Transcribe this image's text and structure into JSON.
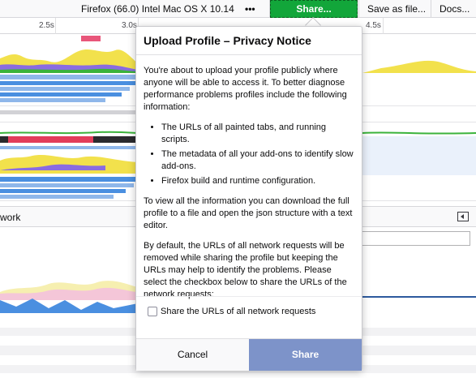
{
  "toolbar": {
    "platform": "Firefox (66.0) Intel Mac OS X 10.14",
    "more": "•••",
    "share": "Share...",
    "save_as_file": "Save as file...",
    "docs": "Docs..."
  },
  "ruler": {
    "ticks": [
      "2.5s",
      "3.0s",
      "4.5s"
    ]
  },
  "network": {
    "label": "work"
  },
  "colors": {
    "share_button": "#12a63a",
    "modal_share": "#7d93c9",
    "js_yellow": "#f2e14c",
    "layout_purple": "#8a6ce0",
    "graphics_green": "#3bb33b",
    "dom_blue": "#4a8fe0",
    "marker_red": "#e23d5a"
  },
  "modal": {
    "title": "Upload Profile – Privacy Notice",
    "intro": "You're about to upload your profile publicly where anyone will be able to access it. To better diagnose performance problems profiles include the following information:",
    "bullets": [
      "The URLs of all painted tabs, and running scripts.",
      "The metadata of all your add-ons to identify slow add-ons.",
      "Firefox build and runtime configuration."
    ],
    "download_note": "To view all the information you can download the full profile to a file and open the json structure with a text editor.",
    "network_note": "By default, the URLs of all network requests will be removed while sharing the profile but keeping the URLs may help to identify the problems. Please select the checkbox below to share the URLs of the network requests:",
    "checkbox_label": "Share the URLs of all network requests",
    "cancel": "Cancel",
    "share": "Share"
  }
}
